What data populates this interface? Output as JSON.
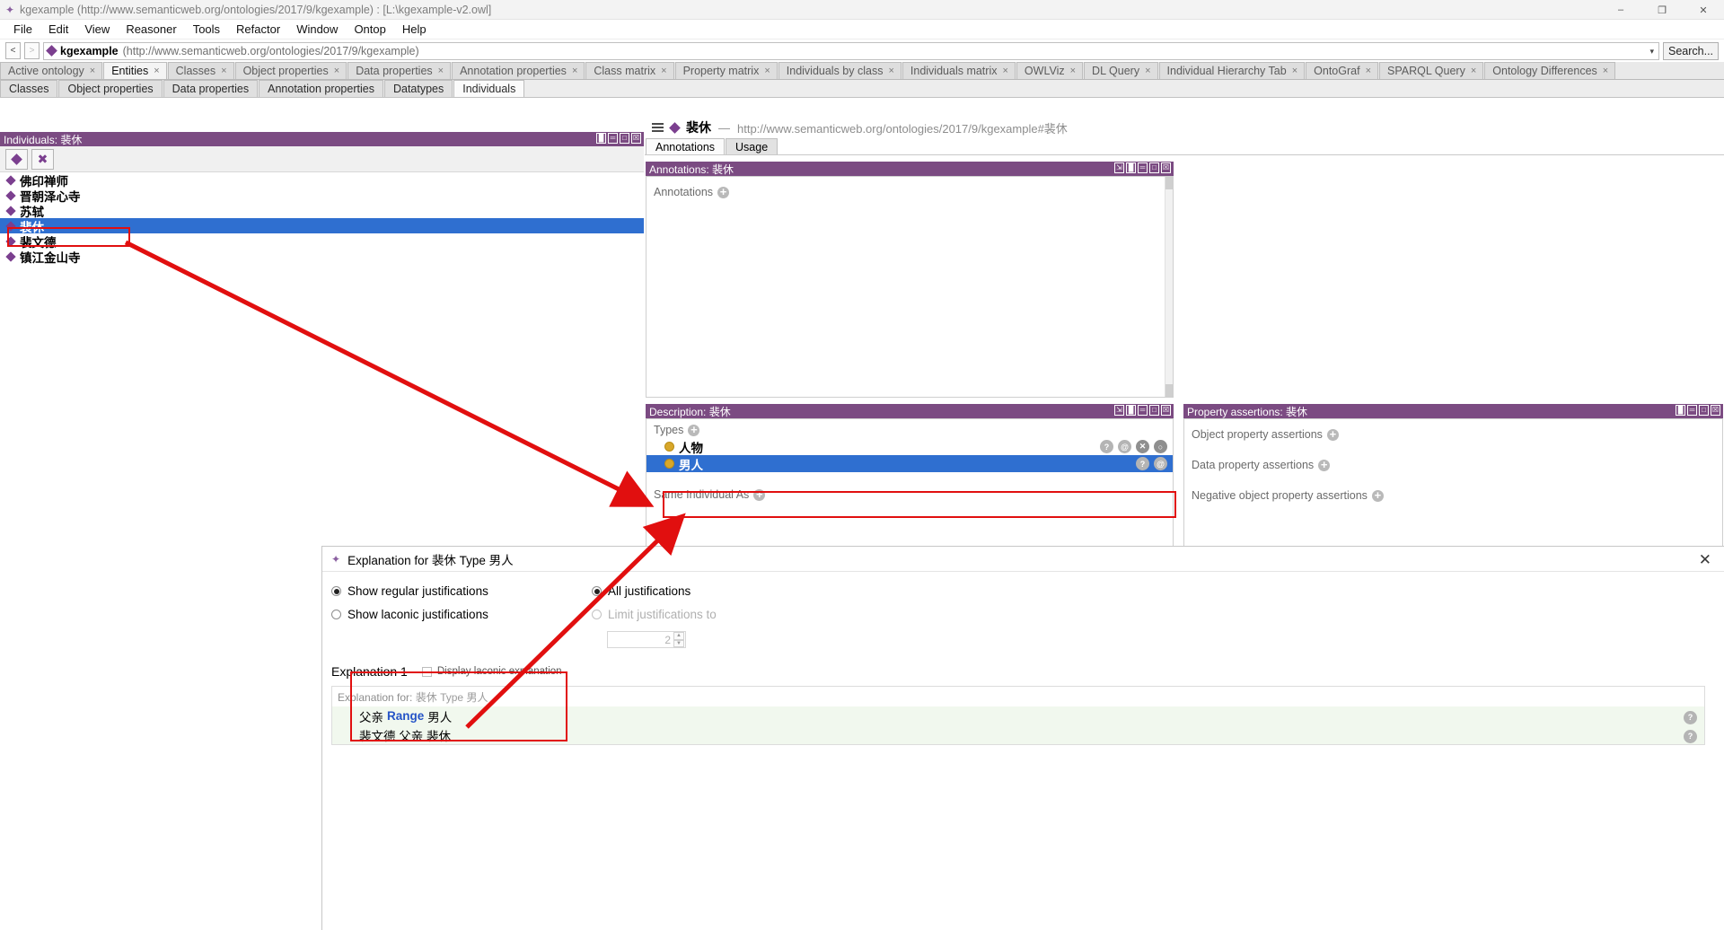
{
  "window": {
    "title": "kgexample (http://www.semanticweb.org/ontologies/2017/9/kgexample)  : [L:\\kgexample-v2.owl]",
    "icon": "protege-icon",
    "minimize": "–",
    "maximize": "❐",
    "close": "✕"
  },
  "menubar": {
    "items": [
      "File",
      "Edit",
      "View",
      "Reasoner",
      "Tools",
      "Refactor",
      "Window",
      "Ontop",
      "Help"
    ]
  },
  "locationbar": {
    "back": "<",
    "forward": ">",
    "ontology_name": "kgexample",
    "ontology_uri": "(http://www.semanticweb.org/ontologies/2017/9/kgexample)",
    "caret": "▾",
    "search_label": "Search..."
  },
  "tabs": {
    "close_glyph": "×",
    "items": [
      {
        "label": "Active ontology",
        "active": false
      },
      {
        "label": "Entities",
        "active": true
      },
      {
        "label": "Classes",
        "active": false
      },
      {
        "label": "Object properties",
        "active": false
      },
      {
        "label": "Data properties",
        "active": false
      },
      {
        "label": "Annotation properties",
        "active": false
      },
      {
        "label": "Class matrix",
        "active": false
      },
      {
        "label": "Property matrix",
        "active": false
      },
      {
        "label": "Individuals by class",
        "active": false
      },
      {
        "label": "Individuals matrix",
        "active": false
      },
      {
        "label": "OWLViz",
        "active": false
      },
      {
        "label": "DL Query",
        "active": false
      },
      {
        "label": "Individual Hierarchy Tab",
        "active": false
      },
      {
        "label": "OntoGraf",
        "active": false
      },
      {
        "label": "SPARQL Query",
        "active": false
      },
      {
        "label": "Ontology Differences",
        "active": false
      }
    ]
  },
  "subtabs": {
    "items": [
      {
        "label": "Classes",
        "active": false
      },
      {
        "label": "Object properties",
        "active": false
      },
      {
        "label": "Data properties",
        "active": false
      },
      {
        "label": "Annotation properties",
        "active": false
      },
      {
        "label": "Datatypes",
        "active": false
      },
      {
        "label": "Individuals",
        "active": true
      }
    ]
  },
  "individuals_panel": {
    "header": "Individuals: 裴休",
    "panel_buttons": [
      "▐▌",
      "═",
      "□",
      "☒"
    ],
    "toolbar": [
      {
        "name": "add-individual-icon",
        "glyph": "◆"
      },
      {
        "name": "delete-individual-icon",
        "glyph": "✕"
      }
    ],
    "items": [
      {
        "label": "佛印禅师",
        "selected": false
      },
      {
        "label": "晋朝泽心寺",
        "selected": false
      },
      {
        "label": "苏轼",
        "selected": false
      },
      {
        "label": "裴休",
        "selected": true
      },
      {
        "label": "裴文德",
        "selected": false
      },
      {
        "label": "镇江金山寺",
        "selected": false
      }
    ]
  },
  "entity_bar": {
    "name": "裴休",
    "separator": "—",
    "uri": "http://www.semanticweb.org/ontologies/2017/9/kgexample#裴休"
  },
  "entity_tabs": {
    "items": [
      {
        "label": "Annotations",
        "active": true
      },
      {
        "label": "Usage",
        "active": false
      }
    ]
  },
  "annotations_panel": {
    "header": "Annotations: 裴休",
    "panel_buttons": [
      "⇲",
      "▐▌",
      "═",
      "□",
      "☒"
    ],
    "section_label": "Annotations"
  },
  "description_panel": {
    "header": "Description: 裴休",
    "panel_buttons": [
      "⇲",
      "▐▌",
      "═",
      "□",
      "☒"
    ],
    "types_label": "Types",
    "types": [
      {
        "label": "人物",
        "selected": false,
        "actions": [
          "?",
          "@",
          "✕",
          "○"
        ]
      },
      {
        "label": "男人",
        "selected": true,
        "actions": [
          "?",
          "@"
        ]
      }
    ],
    "same_individual_label": "Same Individual As"
  },
  "property_assertions_panel": {
    "header": "Property assertions: 裴休",
    "panel_buttons": [
      "▐▌",
      "═",
      "□",
      "☒"
    ],
    "sections": [
      "Object property assertions",
      "Data property assertions",
      "Negative object property assertions"
    ]
  },
  "explanation_dialog": {
    "title": "Explanation for 裴休 Type 男人",
    "icon": "protege-icon",
    "close": "✕",
    "options": [
      {
        "label": "Show regular justifications",
        "selected": true,
        "disabled": false
      },
      {
        "label": "Show laconic justifications",
        "selected": false,
        "disabled": false
      },
      {
        "label": "All justifications",
        "selected": true,
        "disabled": false
      },
      {
        "label": "Limit justifications to",
        "selected": false,
        "disabled": true
      }
    ],
    "limit_value": "2",
    "spin_up": "▲",
    "spin_down": "▼",
    "explanation_header": "Explanation 1",
    "display_laconic_label": "Display laconic explanation",
    "display_laconic_checked": false,
    "explanation_for_prefix": "Explanation for:",
    "explanation_for_subject": "裴休",
    "explanation_for_rel": "Type",
    "explanation_for_object": "男人",
    "axioms": [
      {
        "pre": "父亲",
        "keyword": "Range",
        "post": "男人",
        "help": "?"
      },
      {
        "pre": "裴文德 父亲 裴休",
        "keyword": "",
        "post": "",
        "help": "?"
      }
    ]
  },
  "colors": {
    "panel_header": "#7b4b82",
    "selection": "#2f6fd0",
    "annotation_red": "#e10f0f",
    "keyword_blue": "#2554c7",
    "entity_diamond": "#7b3f8f",
    "class_dot": "#d8a72a"
  }
}
